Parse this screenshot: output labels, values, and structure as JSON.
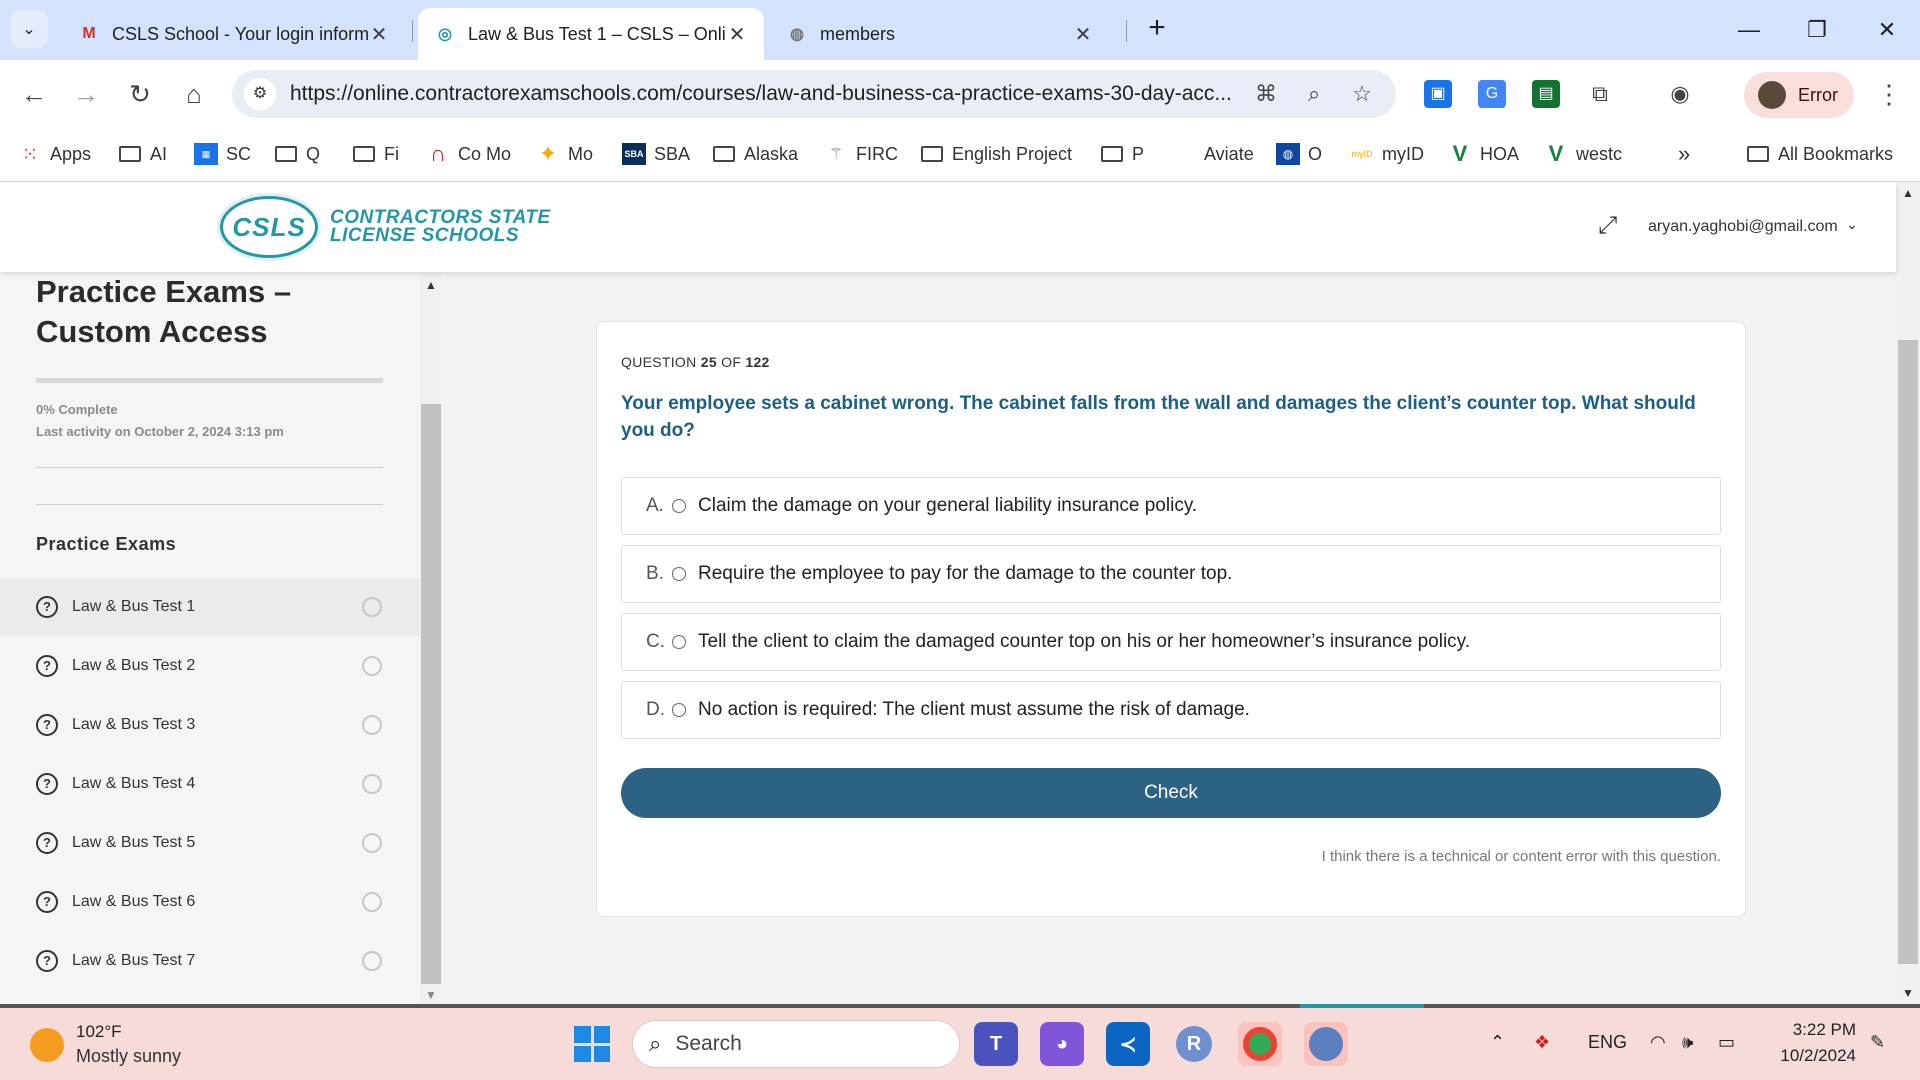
{
  "browser": {
    "tabs": [
      {
        "title": "CSLS School - Your login inform",
        "icon": "gmail-icon"
      },
      {
        "title": "Law & Bus Test 1 – CSLS – Onlir",
        "icon": "csls-favicon"
      },
      {
        "title": "members",
        "icon": "globe-icon"
      }
    ],
    "url": "https://online.contractorexamschools.com/courses/law-and-business-ca-practice-exams-30-day-acc...",
    "profile_label": "Error",
    "bookmarks": [
      {
        "label": "Apps",
        "icon": "apps-grid-icon"
      },
      {
        "label": "AI",
        "icon": "folder-icon"
      },
      {
        "label": "SC",
        "icon": "sc-icon"
      },
      {
        "label": "Q",
        "icon": "folder-icon"
      },
      {
        "label": "Fi",
        "icon": "folder-icon"
      },
      {
        "label": "Co Mo",
        "icon": "red-c-icon"
      },
      {
        "label": "Mo",
        "icon": "star-icon"
      },
      {
        "label": "SBA",
        "icon": "sba-icon"
      },
      {
        "label": "Alaska",
        "icon": "folder-icon"
      },
      {
        "label": "FIRC",
        "icon": "eagle-icon"
      },
      {
        "label": "English Project",
        "icon": "folder-icon"
      },
      {
        "label": "P",
        "icon": "folder-icon"
      },
      {
        "label": "Aviate",
        "icon": "none"
      },
      {
        "label": "O",
        "icon": "globe-icon"
      },
      {
        "label": "myID",
        "icon": "myid-icon"
      },
      {
        "label": "HOA",
        "icon": "check-v-icon"
      },
      {
        "label": "westc",
        "icon": "check-v-icon"
      }
    ],
    "more_bookmarks": "»",
    "all_bookmarks": "All Bookmarks"
  },
  "site": {
    "logo_mark": "CSLS",
    "logo_line1": "CONTRACTORS STATE",
    "logo_line2": "LICENSE SCHOOLS",
    "user_email": "aryan.yaghobi@gmail.com"
  },
  "sidebar": {
    "title": "Practice Exams – Custom Access",
    "complete": "0% Complete",
    "last_activity": "Last activity on October 2, 2024 3:13 pm",
    "section": "Practice Exams",
    "items": [
      {
        "label": "Law & Bus Test 1"
      },
      {
        "label": "Law & Bus Test 2"
      },
      {
        "label": "Law & Bus Test 3"
      },
      {
        "label": "Law & Bus Test 4"
      },
      {
        "label": "Law & Bus Test 5"
      },
      {
        "label": "Law & Bus Test 6"
      },
      {
        "label": "Law & Bus Test 7"
      }
    ]
  },
  "quiz": {
    "counter_prefix": "QUESTION",
    "current": "25",
    "counter_mid": "OF",
    "total": "122",
    "question": "Your employee sets a cabinet wrong. The cabinet falls from the wall and damages the client’s counter top. What should you do?",
    "answers": [
      {
        "letter": "A.",
        "text": "Claim the damage on your general liability insurance policy."
      },
      {
        "letter": "B.",
        "text": "Require the employee to pay for the damage to the counter top."
      },
      {
        "letter": "C.",
        "text": "Tell the client to claim the damaged counter top on his or her homeowner’s insurance policy."
      },
      {
        "letter": "D.",
        "text": "No action is required: The client must assume the risk of damage."
      }
    ],
    "check_label": "Check",
    "report_link": "I think there is a technical or content error with this question."
  },
  "taskbar": {
    "weather_temp": "102°F",
    "weather_desc": "Mostly sunny",
    "search_label": "Search",
    "language": "ENG",
    "time": "3:22 PM",
    "date": "10/2/2024"
  },
  "colors": {
    "accent": "#2c6283",
    "question_text": "#1d5f84",
    "logo": "#2496a7",
    "tabstrip": "#d3e3fd",
    "taskbar": "#f6dbd8"
  }
}
